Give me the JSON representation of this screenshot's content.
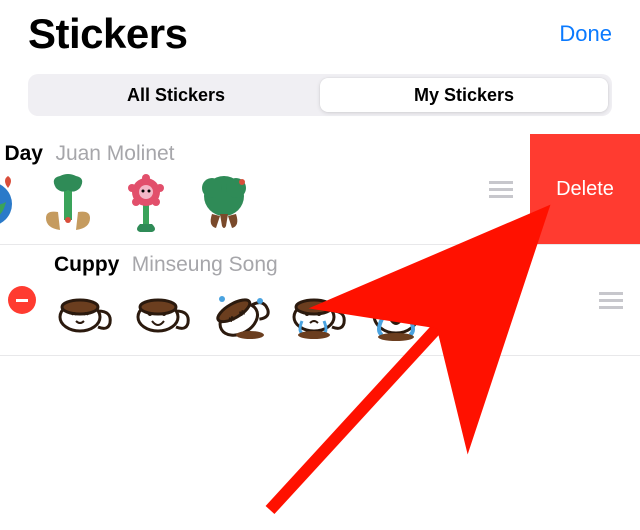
{
  "header": {
    "title": "Stickers",
    "done": "Done"
  },
  "tabs": {
    "all": "All Stickers",
    "my": "My Stickers",
    "activeIndex": 1
  },
  "packs": [
    {
      "name": "World Earth Day",
      "author": "Juan Molinet",
      "swiped": true,
      "showMinus": false
    },
    {
      "name": "Cuppy",
      "author": "Minseung Song",
      "swiped": false,
      "showMinus": true
    }
  ],
  "actions": {
    "delete": "Delete"
  },
  "colors": {
    "accent": "#0a7aff",
    "destructive": "#ff3b30",
    "arrow": "#ff1100"
  }
}
